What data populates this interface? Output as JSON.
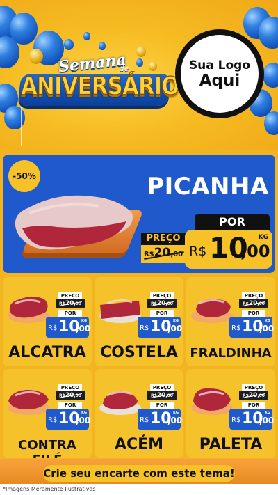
{
  "header": {
    "logo_top": "Semana",
    "logo_connector": "de",
    "logo_bottom": "ANIVERSÁRIO",
    "store_logo_line1": "Sua Logo",
    "store_logo_line2": "Aqui"
  },
  "hero": {
    "discount": "-50%",
    "product": "PICANHA",
    "old_label": "PREÇO",
    "old_price": "20",
    "old_currency": "R$",
    "old_cents": ",00",
    "new_label": "POR",
    "currency": "R$",
    "price_int": "10",
    "price_dec": ",00",
    "unit": "KG"
  },
  "price_labels": {
    "old": "PREÇO",
    "new": "POR",
    "currency": "R$",
    "old_currency": "R$",
    "unit": "KG"
  },
  "products": [
    {
      "name": "ALCATRA",
      "old_price": "20",
      "old_cents": ",00",
      "price_int": "10",
      "price_dec": ",00"
    },
    {
      "name": "COSTELA",
      "old_price": "20",
      "old_cents": ",00",
      "price_int": "10",
      "price_dec": ",00"
    },
    {
      "name": "FRALDINHA",
      "old_price": "20",
      "old_cents": ",00",
      "price_int": "10",
      "price_dec": ",00"
    },
    {
      "name": "CONTRA FILÉ",
      "old_price": "20",
      "old_cents": ",00",
      "price_int": "10",
      "price_dec": ",00"
    },
    {
      "name": "ACÉM",
      "old_price": "20",
      "old_cents": ",00",
      "price_int": "10",
      "price_dec": ",00"
    },
    {
      "name": "PALETA",
      "old_price": "20",
      "old_cents": ",00",
      "price_int": "10",
      "price_dec": ",00"
    }
  ],
  "footer": {
    "cta": "Crie seu encarte com este tema!",
    "disclaimer": "*Imagens Meramente Ilustrativas"
  },
  "colors": {
    "background": "#f3b51f",
    "hero_blue": "#1f59cc",
    "price_yellow": "#f7c227",
    "meat_red": "#b0263a"
  },
  "icons": {
    "balloons": "balloon-icon",
    "meat": "meat-icon"
  }
}
